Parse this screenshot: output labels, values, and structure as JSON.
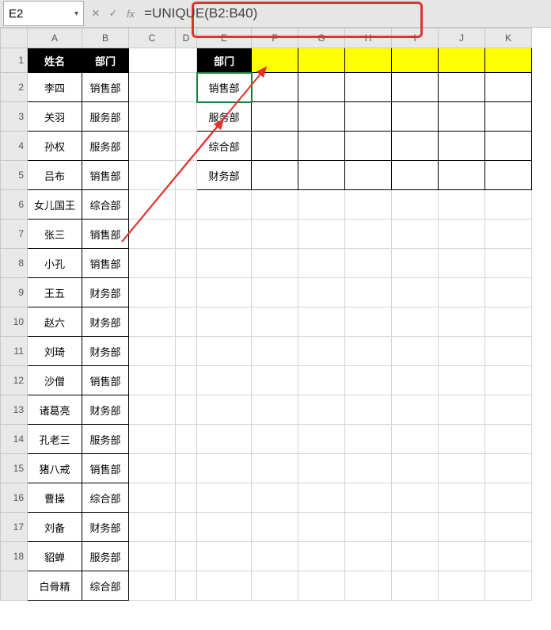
{
  "nameBox": "E2",
  "formula": "=UNIQUE(B2:B40)",
  "colHeaders": [
    "A",
    "B",
    "C",
    "D",
    "E",
    "F",
    "G",
    "H",
    "I",
    "J",
    "K"
  ],
  "rowHeaders": [
    "1",
    "2",
    "3",
    "4",
    "5",
    "6",
    "7",
    "8",
    "9",
    "10",
    "11",
    "12",
    "13",
    "14",
    "15",
    "16",
    "17",
    "18"
  ],
  "leftHeader": {
    "name": "姓名",
    "dept": "部门"
  },
  "leftRows": [
    {
      "n": "李四",
      "d": "销售部"
    },
    {
      "n": "关羽",
      "d": "服务部"
    },
    {
      "n": "孙权",
      "d": "服务部"
    },
    {
      "n": "吕布",
      "d": "销售部"
    },
    {
      "n": "女儿国王",
      "d": "综合部"
    },
    {
      "n": "张三",
      "d": "销售部"
    },
    {
      "n": "小孔",
      "d": "销售部"
    },
    {
      "n": "王五",
      "d": "财务部"
    },
    {
      "n": "赵六",
      "d": "财务部"
    },
    {
      "n": "刘琦",
      "d": "财务部"
    },
    {
      "n": "沙僧",
      "d": "销售部"
    },
    {
      "n": "诸葛亮",
      "d": "财务部"
    },
    {
      "n": "孔老三",
      "d": "服务部"
    },
    {
      "n": "猪八戒",
      "d": "销售部"
    },
    {
      "n": "曹操",
      "d": "综合部"
    },
    {
      "n": "刘备",
      "d": "财务部"
    },
    {
      "n": "貂蝉",
      "d": "服务部"
    },
    {
      "n": "白骨精",
      "d": "综合部"
    }
  ],
  "rightHeader": "部门",
  "rightRows": [
    "销售部",
    "服务部",
    "综合部",
    "财务部"
  ],
  "icons": {
    "cancel": "✕",
    "enter": "✓",
    "dd": "▾"
  }
}
